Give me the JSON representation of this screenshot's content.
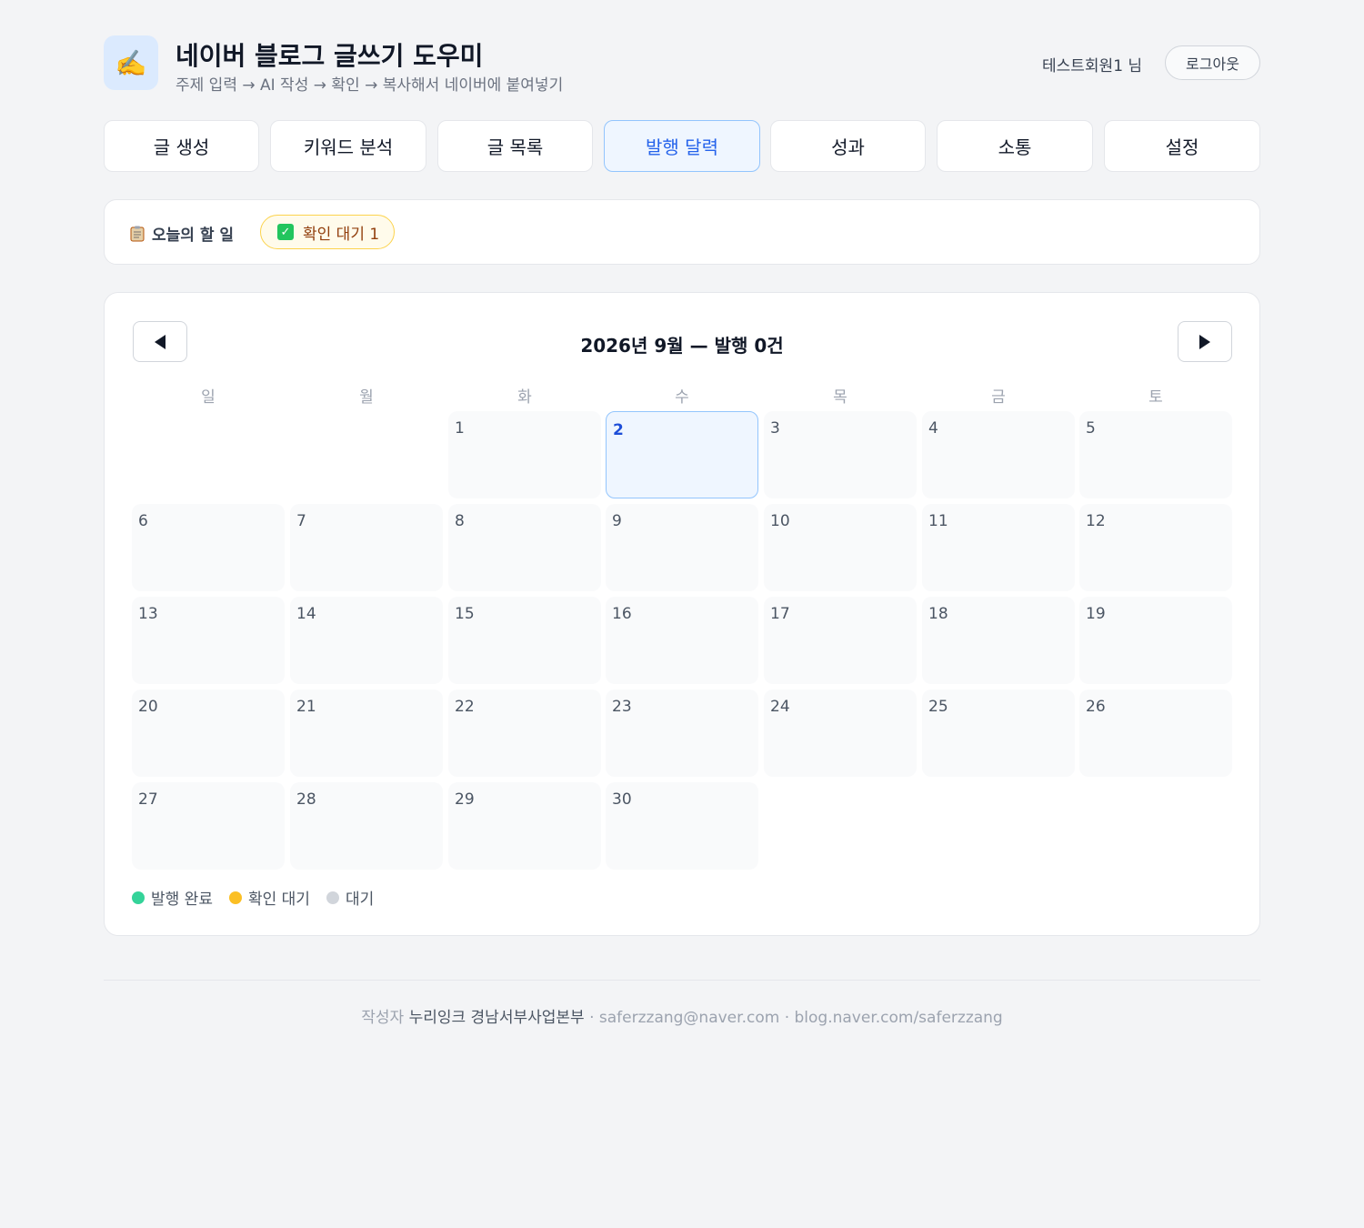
{
  "header": {
    "logo_emoji": "✍️",
    "title": "네이버 블로그 글쓰기 도우미",
    "subtitle": "주제 입력 → AI 작성 → 확인 → 복사해서 네이버에 붙여넣기",
    "user": "테스트회원1 님",
    "logout": "로그아웃"
  },
  "tabs": [
    {
      "label": "글 생성",
      "active": false
    },
    {
      "label": "키워드 분석",
      "active": false
    },
    {
      "label": "글 목록",
      "active": false
    },
    {
      "label": "발행 달력",
      "active": true
    },
    {
      "label": "성과",
      "active": false
    },
    {
      "label": "소통",
      "active": false
    },
    {
      "label": "설정",
      "active": false
    }
  ],
  "today": {
    "icon": "clipboard-icon",
    "label": "오늘의 할 일",
    "badge_icon": "check-icon",
    "badge": "확인 대기 1"
  },
  "calendar": {
    "title": "2026년 9월 — 발행 0건",
    "weekdays": [
      "일",
      "월",
      "화",
      "수",
      "목",
      "금",
      "토"
    ],
    "first_weekday": 2,
    "days_in_month": 30,
    "today": 2,
    "legend": [
      {
        "label": "발행 완료",
        "color": "#34d399"
      },
      {
        "label": "확인 대기",
        "color": "#fbbf24"
      },
      {
        "label": "대기",
        "color": "#d1d5db"
      }
    ]
  },
  "footer": {
    "prefix": "작성자",
    "author": "누리잉크 경남서부사업본부",
    "email": "· saferzzang@naver.com",
    "blog": "· blog.naver.com/saferzzang"
  },
  "colors": {
    "accent": "#2563eb",
    "today_bg": "#eff6ff",
    "badge_bg": "#fffbeb"
  }
}
